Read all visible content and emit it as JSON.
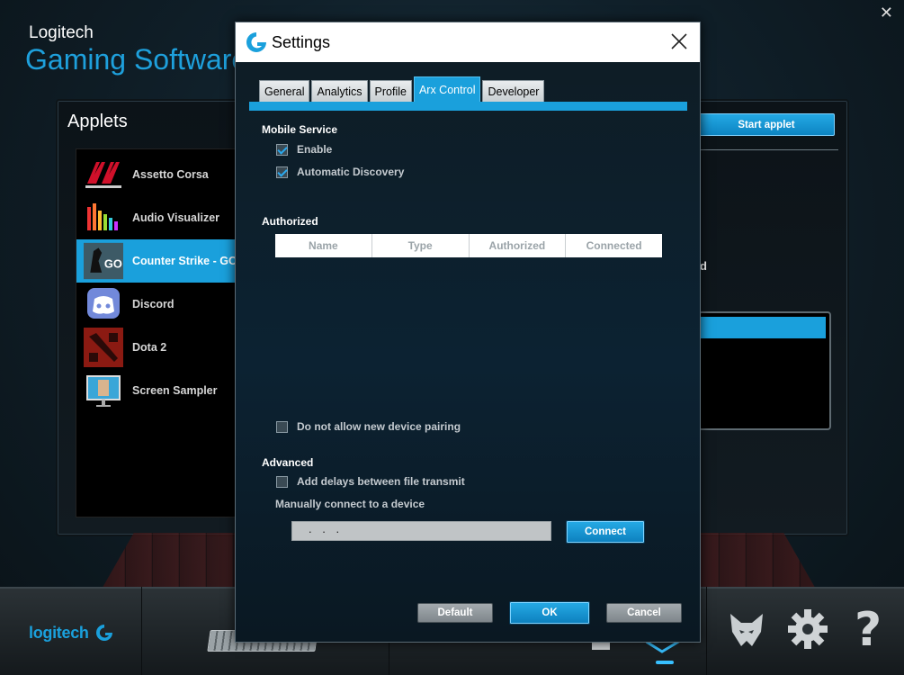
{
  "app": {
    "brand_small": "Logitech",
    "brand_large": "Gaming Software",
    "applets_title": "Applets",
    "start_applet_label": "Start applet",
    "right_fragment": "d",
    "bottom_logo": "logitech"
  },
  "applets": [
    {
      "label": "Assetto Corsa",
      "icon": "assetto-corsa-icon",
      "selected": false
    },
    {
      "label": "Audio Visualizer",
      "icon": "audio-visualizer-icon",
      "selected": false
    },
    {
      "label": "Counter Strike - GO",
      "icon": "counter-strike-icon",
      "selected": true
    },
    {
      "label": "Discord",
      "icon": "discord-icon",
      "selected": false
    },
    {
      "label": "Dota 2",
      "icon": "dota2-icon",
      "selected": false
    },
    {
      "label": "Screen Sampler",
      "icon": "screen-sampler-icon",
      "selected": false
    }
  ],
  "dialog": {
    "title": "Settings",
    "tabs": [
      {
        "label": "General",
        "active": false
      },
      {
        "label": "Analytics",
        "active": false
      },
      {
        "label": "Profile",
        "active": false
      },
      {
        "label": "Arx Control",
        "active": true
      },
      {
        "label": "Developer",
        "active": false
      }
    ],
    "mobile_service": {
      "heading": "Mobile Service",
      "enable_label": "Enable",
      "enable_checked": true,
      "auto_discovery_label": "Automatic Discovery",
      "auto_discovery_checked": true
    },
    "authorized": {
      "heading": "Authorized",
      "columns": [
        "Name",
        "Type",
        "Authorized",
        "Connected"
      ],
      "rows": []
    },
    "no_pairing_label": "Do not allow new device pairing",
    "no_pairing_checked": false,
    "advanced": {
      "heading": "Advanced",
      "delays_label": "Add delays between file transmit",
      "delays_checked": false,
      "manual_label": "Manually connect to a device",
      "ip_value": ". . .",
      "connect_label": "Connect"
    },
    "buttons": {
      "default_label": "Default",
      "ok_label": "OK",
      "cancel_label": "Cancel"
    }
  },
  "colors": {
    "accent": "#1aa0dc",
    "dialog_bg": "#0c2232",
    "titlebar": "#ffffff"
  }
}
